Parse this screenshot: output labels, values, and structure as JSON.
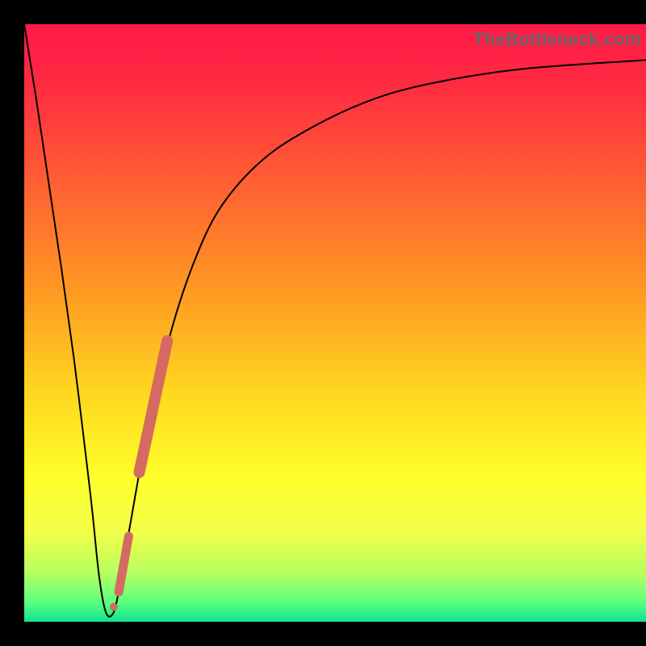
{
  "watermark": "TheBottleneck.com",
  "colors": {
    "frame": "#000000",
    "gradient_stops": [
      {
        "pct": 0,
        "color": "#ff1a49"
      },
      {
        "pct": 10,
        "color": "#ff2a42"
      },
      {
        "pct": 25,
        "color": "#ff5a34"
      },
      {
        "pct": 45,
        "color": "#ff9a22"
      },
      {
        "pct": 62,
        "color": "#ffd820"
      },
      {
        "pct": 76,
        "color": "#ffff2a"
      },
      {
        "pct": 85,
        "color": "#f2ff4a"
      },
      {
        "pct": 92,
        "color": "#b5ff60"
      },
      {
        "pct": 97,
        "color": "#55ff80"
      },
      {
        "pct": 100,
        "color": "#10e090"
      }
    ],
    "curve": "#000000",
    "salmon": "#d46a62"
  },
  "chart_data": {
    "type": "line",
    "title": "",
    "xlabel": "",
    "ylabel": "",
    "xlim": [
      0,
      100
    ],
    "ylim": [
      0,
      100
    ],
    "series": [
      {
        "name": "bottleneck-curve",
        "x": [
          0,
          2,
          4,
          6,
          8,
          10,
          11,
          12,
          13,
          14,
          15,
          17,
          20,
          24,
          28,
          32,
          38,
          45,
          55,
          65,
          80,
          100
        ],
        "y": [
          100,
          87,
          73,
          59,
          44,
          27,
          18,
          8,
          2,
          1,
          4,
          16,
          33,
          50,
          62,
          70,
          77,
          82,
          87,
          90,
          92.5,
          94
        ]
      }
    ],
    "overlay_segments": [
      {
        "name": "salmon-short",
        "x": [
          15.2,
          16.8
        ],
        "y": [
          5.0,
          14.3
        ],
        "width": 11
      },
      {
        "name": "salmon-long",
        "x": [
          18.5,
          23.0
        ],
        "y": [
          25.0,
          47.0
        ],
        "width": 14
      }
    ],
    "overlay_dots": [
      {
        "x": 14.4,
        "y": 2.5,
        "r": 5
      },
      {
        "x": 15.2,
        "y": 5.0,
        "r": 5
      }
    ]
  }
}
